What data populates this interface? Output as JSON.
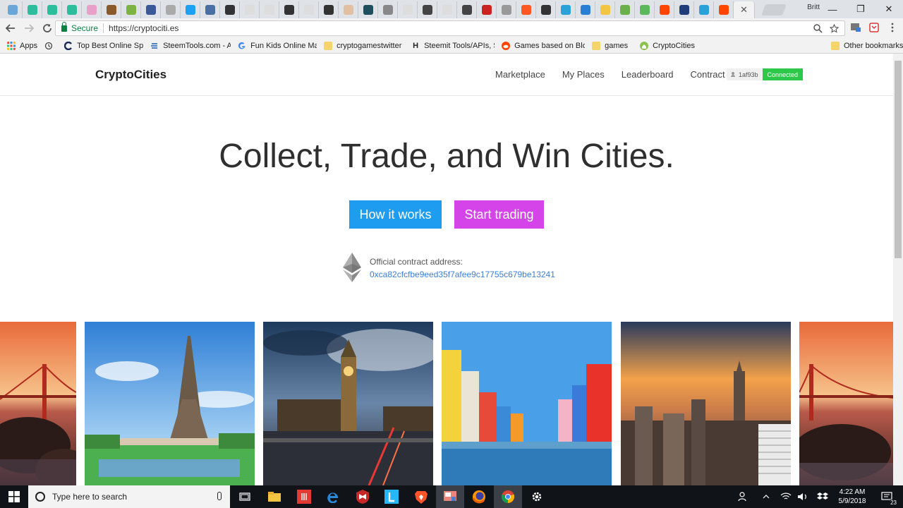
{
  "browser": {
    "profile_name": "Britt",
    "window_controls": {
      "minimize": "—",
      "restore": "❐",
      "close": "✕"
    },
    "address": {
      "secure_label": "Secure",
      "url": "https://cryptociti.es"
    },
    "tab_favicon_colors": [
      "#6aa6d8",
      "#2bbd9c",
      "#2bbd9c",
      "#2bbd9c",
      "#e8a0c8",
      "#8b5a2b",
      "#7cb342",
      "#3b5998",
      "#aaaaaa",
      "#1da1f2",
      "#4a6fa5",
      "#333333",
      "#dddddd",
      "#dddddd",
      "#333333",
      "#dddddd",
      "#333333",
      "#e0c0a0",
      "#1f4e5f",
      "#888888",
      "#dddddd",
      "#444444",
      "#dddddd",
      "#444444",
      "#cc2222",
      "#999999",
      "#ff5722",
      "#333333",
      "#2aa1d8",
      "#2a7fd5",
      "#f4c542",
      "#6ab04c",
      "#5cb85c",
      "#ff4500",
      "#1f3d7a",
      "#2aa1d8",
      "#ff4500"
    ],
    "bookmarks": [
      {
        "label": "Apps",
        "icon": "apps-grid-icon"
      },
      {
        "label": "",
        "icon": "history-icon"
      },
      {
        "label": "Top Best Online Spo",
        "icon": "c-logo-icon"
      },
      {
        "label": "SteemTools.com - A",
        "icon": "steem-icon"
      },
      {
        "label": "Fun Kids Online Mat",
        "icon": "google-icon"
      },
      {
        "label": "cryptogamestwitter",
        "icon": "folder-icon"
      },
      {
        "label": "Steemit Tools/APIs, S",
        "icon": "h-icon"
      },
      {
        "label": "Games based on Blo",
        "icon": "reddit-icon"
      },
      {
        "label": "games",
        "icon": "folder-icon"
      },
      {
        "label": "CryptoCities",
        "icon": "cryptocities-icon"
      }
    ],
    "other_bookmarks": "Other bookmarks"
  },
  "site": {
    "brand": "CryptoCities",
    "nav_links": [
      "Marketplace",
      "My Places",
      "Leaderboard",
      "Contract"
    ],
    "account_id": "1af93b",
    "connection_status": "Connected",
    "headline": "Collect, Trade, and Win Cities.",
    "buttons": {
      "how": "How it works",
      "trade": "Start trading"
    },
    "contract_label": "Official contract address:",
    "contract_address": "0xca82cfcfbe9eed35f7afee9c17755c679be13241",
    "city_photos": [
      "San Francisco",
      "Paris",
      "London",
      "Burano",
      "New York",
      "San Francisco"
    ]
  },
  "taskbar": {
    "search_placeholder": "Type here to search",
    "time": "4:22 AM",
    "date": "5/9/2018",
    "notification_count": "23"
  },
  "colors": {
    "how_button": "#1e9cf0",
    "trade_button": "#d544e8",
    "connected": "#2bc84a",
    "contract_link": "#3a7fd5"
  }
}
